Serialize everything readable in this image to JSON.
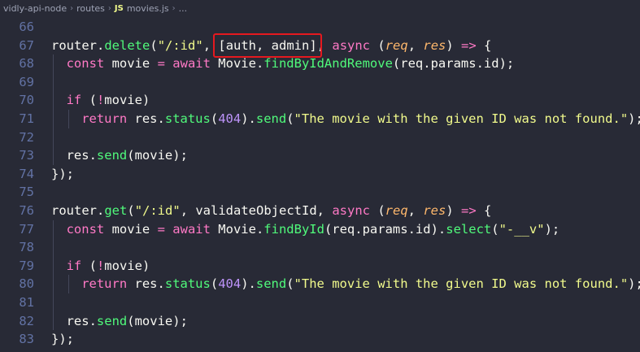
{
  "breadcrumb": {
    "project": "vidly-api-node",
    "folder": "routes",
    "file_badge": "JS",
    "file": "movies.js",
    "more": "..."
  },
  "lines": [
    {
      "num": "66",
      "tokens": []
    },
    {
      "num": "67",
      "tokens": [
        {
          "c": "obj",
          "t": "router"
        },
        {
          "c": "pun",
          "t": "."
        },
        {
          "c": "fn",
          "t": "delete"
        },
        {
          "c": "pun",
          "t": "("
        },
        {
          "c": "str",
          "t": "\"/:id\""
        },
        {
          "c": "pun",
          "t": ", "
        },
        {
          "c": "pun",
          "t": "[auth, admin]"
        },
        {
          "c": "pun",
          "t": ", "
        },
        {
          "c": "kw",
          "t": "async"
        },
        {
          "c": "pun",
          "t": " ("
        },
        {
          "c": "par",
          "t": "req"
        },
        {
          "c": "pun",
          "t": ", "
        },
        {
          "c": "par",
          "t": "res"
        },
        {
          "c": "pun",
          "t": ") "
        },
        {
          "c": "kw",
          "t": "=>"
        },
        {
          "c": "pun",
          "t": " {"
        }
      ]
    },
    {
      "num": "68",
      "indent": 1,
      "tokens": [
        {
          "c": "kw",
          "t": "const"
        },
        {
          "c": "pun",
          "t": " movie "
        },
        {
          "c": "kw",
          "t": "="
        },
        {
          "c": "pun",
          "t": " "
        },
        {
          "c": "kw",
          "t": "await"
        },
        {
          "c": "pun",
          "t": " Movie."
        },
        {
          "c": "fn",
          "t": "findByIdAndRemove"
        },
        {
          "c": "pun",
          "t": "(req.params.id);"
        }
      ]
    },
    {
      "num": "69",
      "indent": 1,
      "tokens": []
    },
    {
      "num": "70",
      "indent": 1,
      "tokens": [
        {
          "c": "kw",
          "t": "if"
        },
        {
          "c": "pun",
          "t": " ("
        },
        {
          "c": "kw",
          "t": "!"
        },
        {
          "c": "pun",
          "t": "movie)"
        }
      ]
    },
    {
      "num": "71",
      "indent": 2,
      "tokens": [
        {
          "c": "kw",
          "t": "return"
        },
        {
          "c": "pun",
          "t": " res."
        },
        {
          "c": "fn",
          "t": "status"
        },
        {
          "c": "pun",
          "t": "("
        },
        {
          "c": "num",
          "t": "404"
        },
        {
          "c": "pun",
          "t": ")."
        },
        {
          "c": "fn",
          "t": "send"
        },
        {
          "c": "pun",
          "t": "("
        },
        {
          "c": "str",
          "t": "\"The movie with the given ID was not found.\""
        },
        {
          "c": "pun",
          "t": ");"
        }
      ]
    },
    {
      "num": "72",
      "indent": 1,
      "tokens": []
    },
    {
      "num": "73",
      "indent": 1,
      "tokens": [
        {
          "c": "pun",
          "t": "res."
        },
        {
          "c": "fn",
          "t": "send"
        },
        {
          "c": "pun",
          "t": "(movie);"
        }
      ]
    },
    {
      "num": "74",
      "tokens": [
        {
          "c": "pun",
          "t": "});"
        }
      ]
    },
    {
      "num": "75",
      "tokens": []
    },
    {
      "num": "76",
      "tokens": [
        {
          "c": "obj",
          "t": "router"
        },
        {
          "c": "pun",
          "t": "."
        },
        {
          "c": "fn",
          "t": "get"
        },
        {
          "c": "pun",
          "t": "("
        },
        {
          "c": "str",
          "t": "\"/:id\""
        },
        {
          "c": "pun",
          "t": ", validateObjectId, "
        },
        {
          "c": "kw",
          "t": "async"
        },
        {
          "c": "pun",
          "t": " ("
        },
        {
          "c": "par",
          "t": "req"
        },
        {
          "c": "pun",
          "t": ", "
        },
        {
          "c": "par",
          "t": "res"
        },
        {
          "c": "pun",
          "t": ") "
        },
        {
          "c": "kw",
          "t": "=>"
        },
        {
          "c": "pun",
          "t": " {"
        }
      ]
    },
    {
      "num": "77",
      "indent": 1,
      "tokens": [
        {
          "c": "kw",
          "t": "const"
        },
        {
          "c": "pun",
          "t": " movie "
        },
        {
          "c": "kw",
          "t": "="
        },
        {
          "c": "pun",
          "t": " "
        },
        {
          "c": "kw",
          "t": "await"
        },
        {
          "c": "pun",
          "t": " Movie."
        },
        {
          "c": "fn",
          "t": "findById"
        },
        {
          "c": "pun",
          "t": "(req.params.id)."
        },
        {
          "c": "fn",
          "t": "select"
        },
        {
          "c": "pun",
          "t": "("
        },
        {
          "c": "str",
          "t": "\"-__v\""
        },
        {
          "c": "pun",
          "t": ");"
        }
      ]
    },
    {
      "num": "78",
      "indent": 1,
      "tokens": []
    },
    {
      "num": "79",
      "indent": 1,
      "tokens": [
        {
          "c": "kw",
          "t": "if"
        },
        {
          "c": "pun",
          "t": " ("
        },
        {
          "c": "kw",
          "t": "!"
        },
        {
          "c": "pun",
          "t": "movie)"
        }
      ]
    },
    {
      "num": "80",
      "indent": 2,
      "tokens": [
        {
          "c": "kw",
          "t": "return"
        },
        {
          "c": "pun",
          "t": " res."
        },
        {
          "c": "fn",
          "t": "status"
        },
        {
          "c": "pun",
          "t": "("
        },
        {
          "c": "num",
          "t": "404"
        },
        {
          "c": "pun",
          "t": ")."
        },
        {
          "c": "fn",
          "t": "send"
        },
        {
          "c": "pun",
          "t": "("
        },
        {
          "c": "str",
          "t": "\"The movie with the given ID was not found.\""
        },
        {
          "c": "pun",
          "t": ");"
        }
      ]
    },
    {
      "num": "81",
      "indent": 1,
      "tokens": []
    },
    {
      "num": "82",
      "indent": 1,
      "tokens": [
        {
          "c": "pun",
          "t": "res."
        },
        {
          "c": "fn",
          "t": "send"
        },
        {
          "c": "pun",
          "t": "(movie);"
        }
      ]
    },
    {
      "num": "83",
      "tokens": [
        {
          "c": "pun",
          "t": "});"
        }
      ]
    }
  ],
  "highlight": {
    "text": "[auth, admin]",
    "color": "#e5191f"
  },
  "theme": {
    "background": "#282a36",
    "line_number": "#6272a4",
    "keyword": "#ff79c6",
    "function": "#50fa7b",
    "string": "#f1fa8c",
    "number": "#bd93f9",
    "parameter": "#ffb86c"
  }
}
